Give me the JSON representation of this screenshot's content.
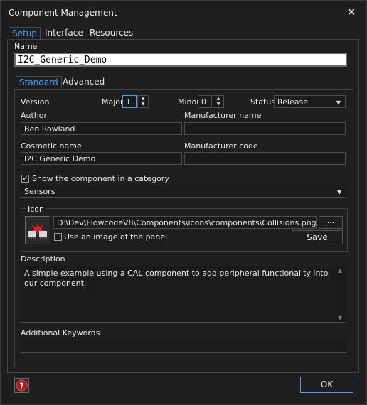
{
  "window": {
    "title": "Component Management",
    "close_glyph": "✕"
  },
  "top_tabs": [
    {
      "label": "Setup",
      "active": true
    },
    {
      "label": "Interface",
      "active": false
    },
    {
      "label": "Resources",
      "active": false
    }
  ],
  "name": {
    "label": "Name",
    "value": "I2C_Generic_Demo"
  },
  "sub_tabs": [
    {
      "label": "Standard",
      "active": true
    },
    {
      "label": "Advanced",
      "active": false
    }
  ],
  "version": {
    "label": "Version",
    "major_label": "Major",
    "major_value": "1",
    "minor_label": "Minor",
    "minor_value": "0",
    "status_label": "Status",
    "status_value": "Release"
  },
  "author": {
    "label": "Author",
    "value": "Ben Rowland"
  },
  "manufacturer_name": {
    "label": "Manufacturer name",
    "value": ""
  },
  "cosmetic_name": {
    "label": "Cosmetic name",
    "value": "I2C Generic Demo"
  },
  "manufacturer_code": {
    "label": "Manufacturer code",
    "value": ""
  },
  "category": {
    "show_label": "Show the component in a category",
    "checked": true,
    "value": "Sensors"
  },
  "icon": {
    "group_label": "Icon",
    "path": "D:\\Dev\\FlowcodeV8\\Components\\icons\\components\\Collisions.png",
    "browse_label": "...",
    "use_panel_label": "Use an image of the panel",
    "use_panel_checked": false,
    "save_label": "Save"
  },
  "description": {
    "label": "Description",
    "value": "A simple example using a CAL component to add peripheral functionality into our component."
  },
  "keywords": {
    "label": "Additional Keywords",
    "value": ""
  },
  "footer": {
    "ok_label": "OK",
    "help_icon": "help-icon"
  },
  "colors": {
    "accent": "#3ea3ff",
    "background": "#1f1f1f",
    "field": "#1b1b1b"
  }
}
